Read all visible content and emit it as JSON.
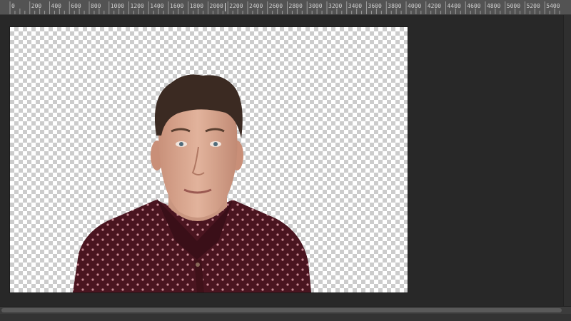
{
  "ruler": {
    "labels": [
      "0",
      "200",
      "400",
      "600",
      "800",
      "1000",
      "1200",
      "1400",
      "1600",
      "1800",
      "2000",
      "2200",
      "2400",
      "2600",
      "2800",
      "3000",
      "3200",
      "3400",
      "3600",
      "3800",
      "4000",
      "4200",
      "4400",
      "4600",
      "4800",
      "5000",
      "5200",
      "5400"
    ]
  },
  "document": {
    "background": "transparent-checkerboard",
    "subject": "portrait-cutout"
  },
  "colors": {
    "workspace": "#282828",
    "ruler": "#535353",
    "checker_light": "#ffffff",
    "checker_dark": "#cccccc",
    "shirt": "#4a1520"
  }
}
